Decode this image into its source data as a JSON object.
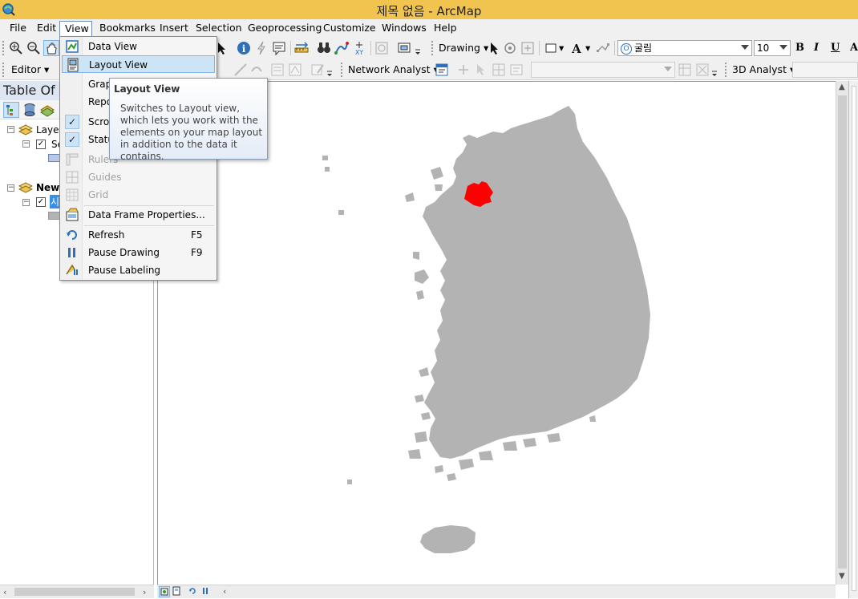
{
  "window": {
    "title": "제목 없음 - ArcMap"
  },
  "menubar": {
    "items": [
      "File",
      "Edit",
      "View",
      "Bookmarks",
      "Insert",
      "Selection",
      "Geoprocessing",
      "Customize",
      "Windows",
      "Help"
    ],
    "active": "View"
  },
  "toolbar1": {
    "drawing_label": "Drawing",
    "font_name": "굴림",
    "font_size": "10",
    "bold": "B",
    "italic": "I",
    "underline": "U",
    "text_tool": "A"
  },
  "toolbar2": {
    "editor_label": "Editor",
    "network_analyst_label": "Network Analyst",
    "analyst3d_label": "3D Analyst"
  },
  "toc": {
    "title": "Table Of C",
    "layers_group": "Layer",
    "layers_child": "Se",
    "new_group": "New",
    "new_child": "시"
  },
  "view_menu": {
    "items": [
      {
        "label": "Data View",
        "icon": "data-view-icon"
      },
      {
        "label": "Layout View",
        "icon": "layout-view-icon",
        "highlighted": true
      },
      {
        "label": "Graph",
        "icon": ""
      },
      {
        "label": "Repo",
        "icon": ""
      },
      {
        "label": "Scrol",
        "checked": true
      },
      {
        "label": "Statu",
        "checked": true
      },
      {
        "label": "Rulers",
        "disabled": true,
        "icon": "rulers-icon"
      },
      {
        "label": "Guides",
        "disabled": true,
        "icon": "guides-icon"
      },
      {
        "label": "Grid",
        "disabled": true,
        "icon": "grid-icon"
      },
      {
        "label": "Data Frame Properties...",
        "icon": "data-frame-properties-icon"
      },
      {
        "label": "Refresh",
        "shortcut": "F5",
        "icon": "refresh-icon"
      },
      {
        "label": "Pause Drawing",
        "shortcut": "F9",
        "icon": "pause-icon"
      },
      {
        "label": "Pause Labeling",
        "icon": "pause-labeling-icon"
      }
    ]
  },
  "tooltip": {
    "title": "Layout View",
    "body": "Switches to Layout view, which lets you work with the elements on your map layout in addition to the data it contains."
  },
  "colors": {
    "title_bar": "#f0c44f",
    "land": "#b3b3b3",
    "highlight": "#ff0000",
    "menu_highlight": "#cde4f7"
  }
}
